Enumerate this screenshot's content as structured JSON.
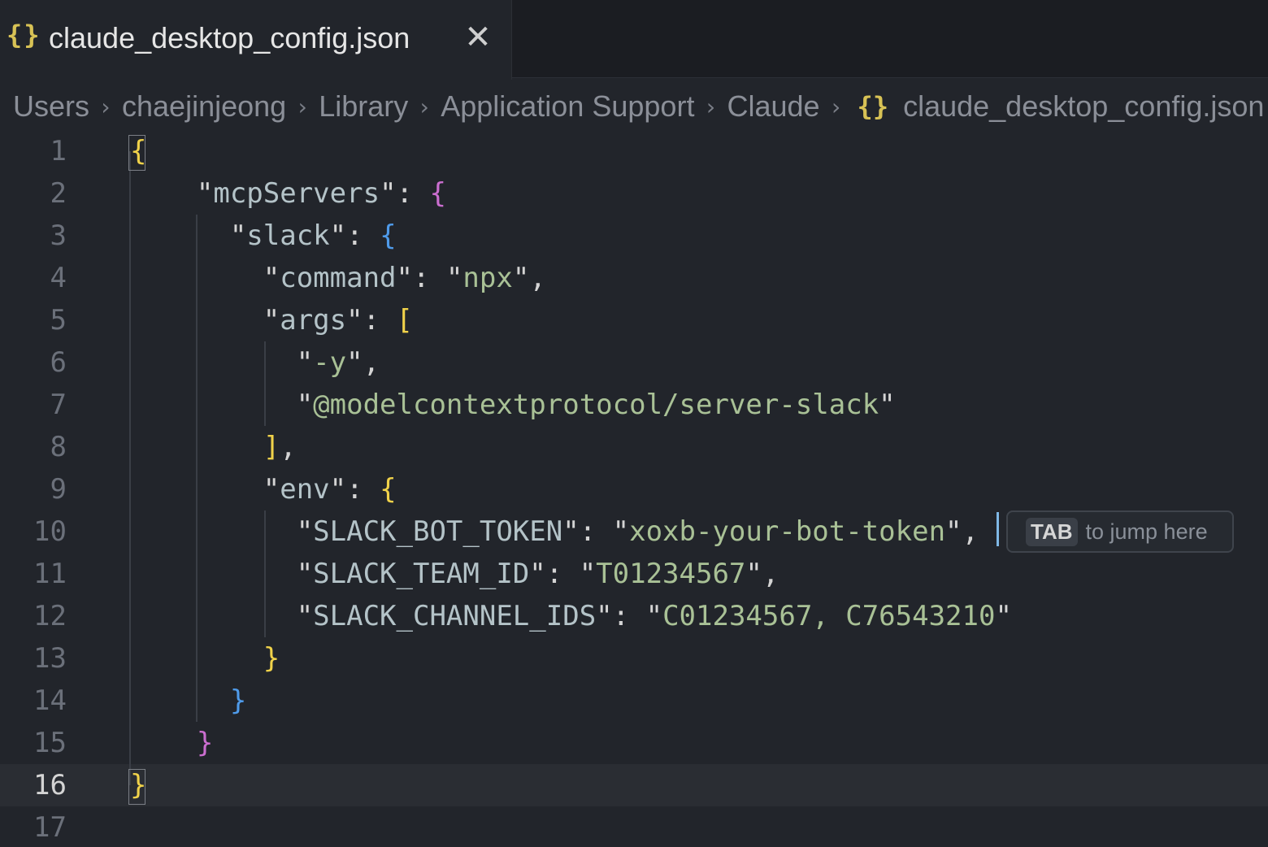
{
  "tab": {
    "icon": "{}",
    "icon_name": "json-braces-icon",
    "title": "claude_desktop_config.json",
    "close_symbol": "✕"
  },
  "breadcrumb": {
    "items": [
      "Users",
      "chaejinjeong",
      "Library",
      "Application Support",
      "Claude"
    ],
    "file_icon": "{}",
    "file": "claude_desktop_config.json"
  },
  "editor": {
    "current_line": 16,
    "lines": [
      {
        "n": "1",
        "tokens": [
          [
            "b1",
            "{"
          ]
        ]
      },
      {
        "n": "2",
        "tokens": [
          [
            "p",
            "    \""
          ],
          [
            "k",
            "mcpServers"
          ],
          [
            "p",
            "\": "
          ],
          [
            "b2",
            "{"
          ]
        ]
      },
      {
        "n": "3",
        "tokens": [
          [
            "p",
            "      \""
          ],
          [
            "k",
            "slack"
          ],
          [
            "p",
            "\": "
          ],
          [
            "b3",
            "{"
          ]
        ]
      },
      {
        "n": "4",
        "tokens": [
          [
            "p",
            "        \""
          ],
          [
            "k",
            "command"
          ],
          [
            "p",
            "\": \""
          ],
          [
            "s",
            "npx"
          ],
          [
            "p",
            "\","
          ]
        ]
      },
      {
        "n": "5",
        "tokens": [
          [
            "p",
            "        \""
          ],
          [
            "k",
            "args"
          ],
          [
            "p",
            "\": "
          ],
          [
            "b1",
            "["
          ]
        ]
      },
      {
        "n": "6",
        "tokens": [
          [
            "p",
            "          \""
          ],
          [
            "s",
            "-y"
          ],
          [
            "p",
            "\","
          ]
        ]
      },
      {
        "n": "7",
        "tokens": [
          [
            "p",
            "          \""
          ],
          [
            "s",
            "@modelcontextprotocol/server-slack"
          ],
          [
            "p",
            "\""
          ]
        ]
      },
      {
        "n": "8",
        "tokens": [
          [
            "p",
            "        "
          ],
          [
            "b1",
            "]"
          ],
          [
            "p",
            ","
          ]
        ]
      },
      {
        "n": "9",
        "tokens": [
          [
            "p",
            "        \""
          ],
          [
            "k",
            "env"
          ],
          [
            "p",
            "\": "
          ],
          [
            "b1",
            "{"
          ]
        ]
      },
      {
        "n": "10",
        "tokens": [
          [
            "p",
            "          \""
          ],
          [
            "k",
            "SLACK_BOT_TOKEN"
          ],
          [
            "p",
            "\": \""
          ],
          [
            "s",
            "xoxb-your-bot-token"
          ],
          [
            "p",
            "\","
          ]
        ]
      },
      {
        "n": "11",
        "tokens": [
          [
            "p",
            "          \""
          ],
          [
            "k",
            "SLACK_TEAM_ID"
          ],
          [
            "p",
            "\": \""
          ],
          [
            "s",
            "T01234567"
          ],
          [
            "p",
            "\","
          ]
        ]
      },
      {
        "n": "12",
        "tokens": [
          [
            "p",
            "          \""
          ],
          [
            "k",
            "SLACK_CHANNEL_IDS"
          ],
          [
            "p",
            "\": \""
          ],
          [
            "s",
            "C01234567, C76543210"
          ],
          [
            "p",
            "\""
          ]
        ]
      },
      {
        "n": "13",
        "tokens": [
          [
            "p",
            "        "
          ],
          [
            "b1",
            "}"
          ]
        ]
      },
      {
        "n": "14",
        "tokens": [
          [
            "p",
            "      "
          ],
          [
            "b3",
            "}"
          ]
        ]
      },
      {
        "n": "15",
        "tokens": [
          [
            "p",
            "    "
          ],
          [
            "b2",
            "}"
          ]
        ]
      },
      {
        "n": "16",
        "tokens": [
          [
            "b1",
            "}"
          ]
        ]
      },
      {
        "n": "17",
        "tokens": []
      }
    ]
  },
  "inline_hint": {
    "key": "TAB",
    "text": "to jump here"
  },
  "colors": {
    "background": "#22252b",
    "string": "#a9c196",
    "key": "#b4c3c8",
    "bracket_yellow": "#f0d24a",
    "bracket_magenta": "#cb6ed0",
    "bracket_blue": "#4f9bea"
  }
}
